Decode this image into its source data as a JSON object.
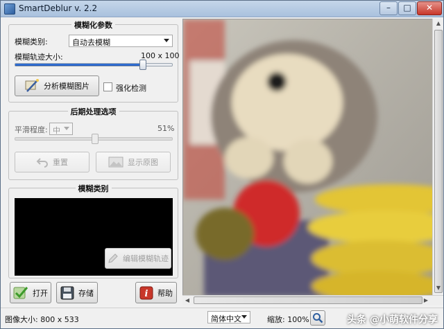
{
  "window": {
    "title": "SmartDeblur v. 2.2"
  },
  "params": {
    "title": "模糊化参数",
    "blur_type_label": "模糊类别:",
    "blur_type_value": "自动去模糊",
    "track_size_label": "模糊轨迹大小:",
    "track_size_w": "100",
    "track_size_x": "x",
    "track_size_h": "100",
    "track_slider_fraction": 0.83,
    "analyze_button": "分析模糊图片",
    "enhance_label": "强化检测",
    "enhance_checked": false
  },
  "post": {
    "title": "后期处理选项",
    "smooth_label": "平滑程度:",
    "smooth_value": "中",
    "smooth_percent": "51%",
    "smooth_slider_fraction": 0.51,
    "reset_button": "重置",
    "show_original_button": "显示原图"
  },
  "blur_kind": {
    "title": "模糊类别",
    "edit_button": "编辑模糊轨迹"
  },
  "bottom_buttons": {
    "open": "打开",
    "save": "存储",
    "help": "帮助"
  },
  "status": {
    "image_size": "图像大小: 800 x 533",
    "language": "简体中文",
    "zoom_label": "缩放: 100%"
  },
  "watermark": "头条 @小萌软件分享",
  "colors": {
    "accent": "#1d56b8",
    "help_red": "#c8372a",
    "open_green": "#3c9a2a"
  },
  "icons": {
    "app": "app-icon",
    "analyze": "wand-icon",
    "reset": "undo-icon",
    "show_original": "image-icon",
    "edit": "pencil-icon",
    "open": "checkmark-icon",
    "save": "floppy-icon",
    "help": "info-icon",
    "zoom": "magnifier-icon"
  }
}
